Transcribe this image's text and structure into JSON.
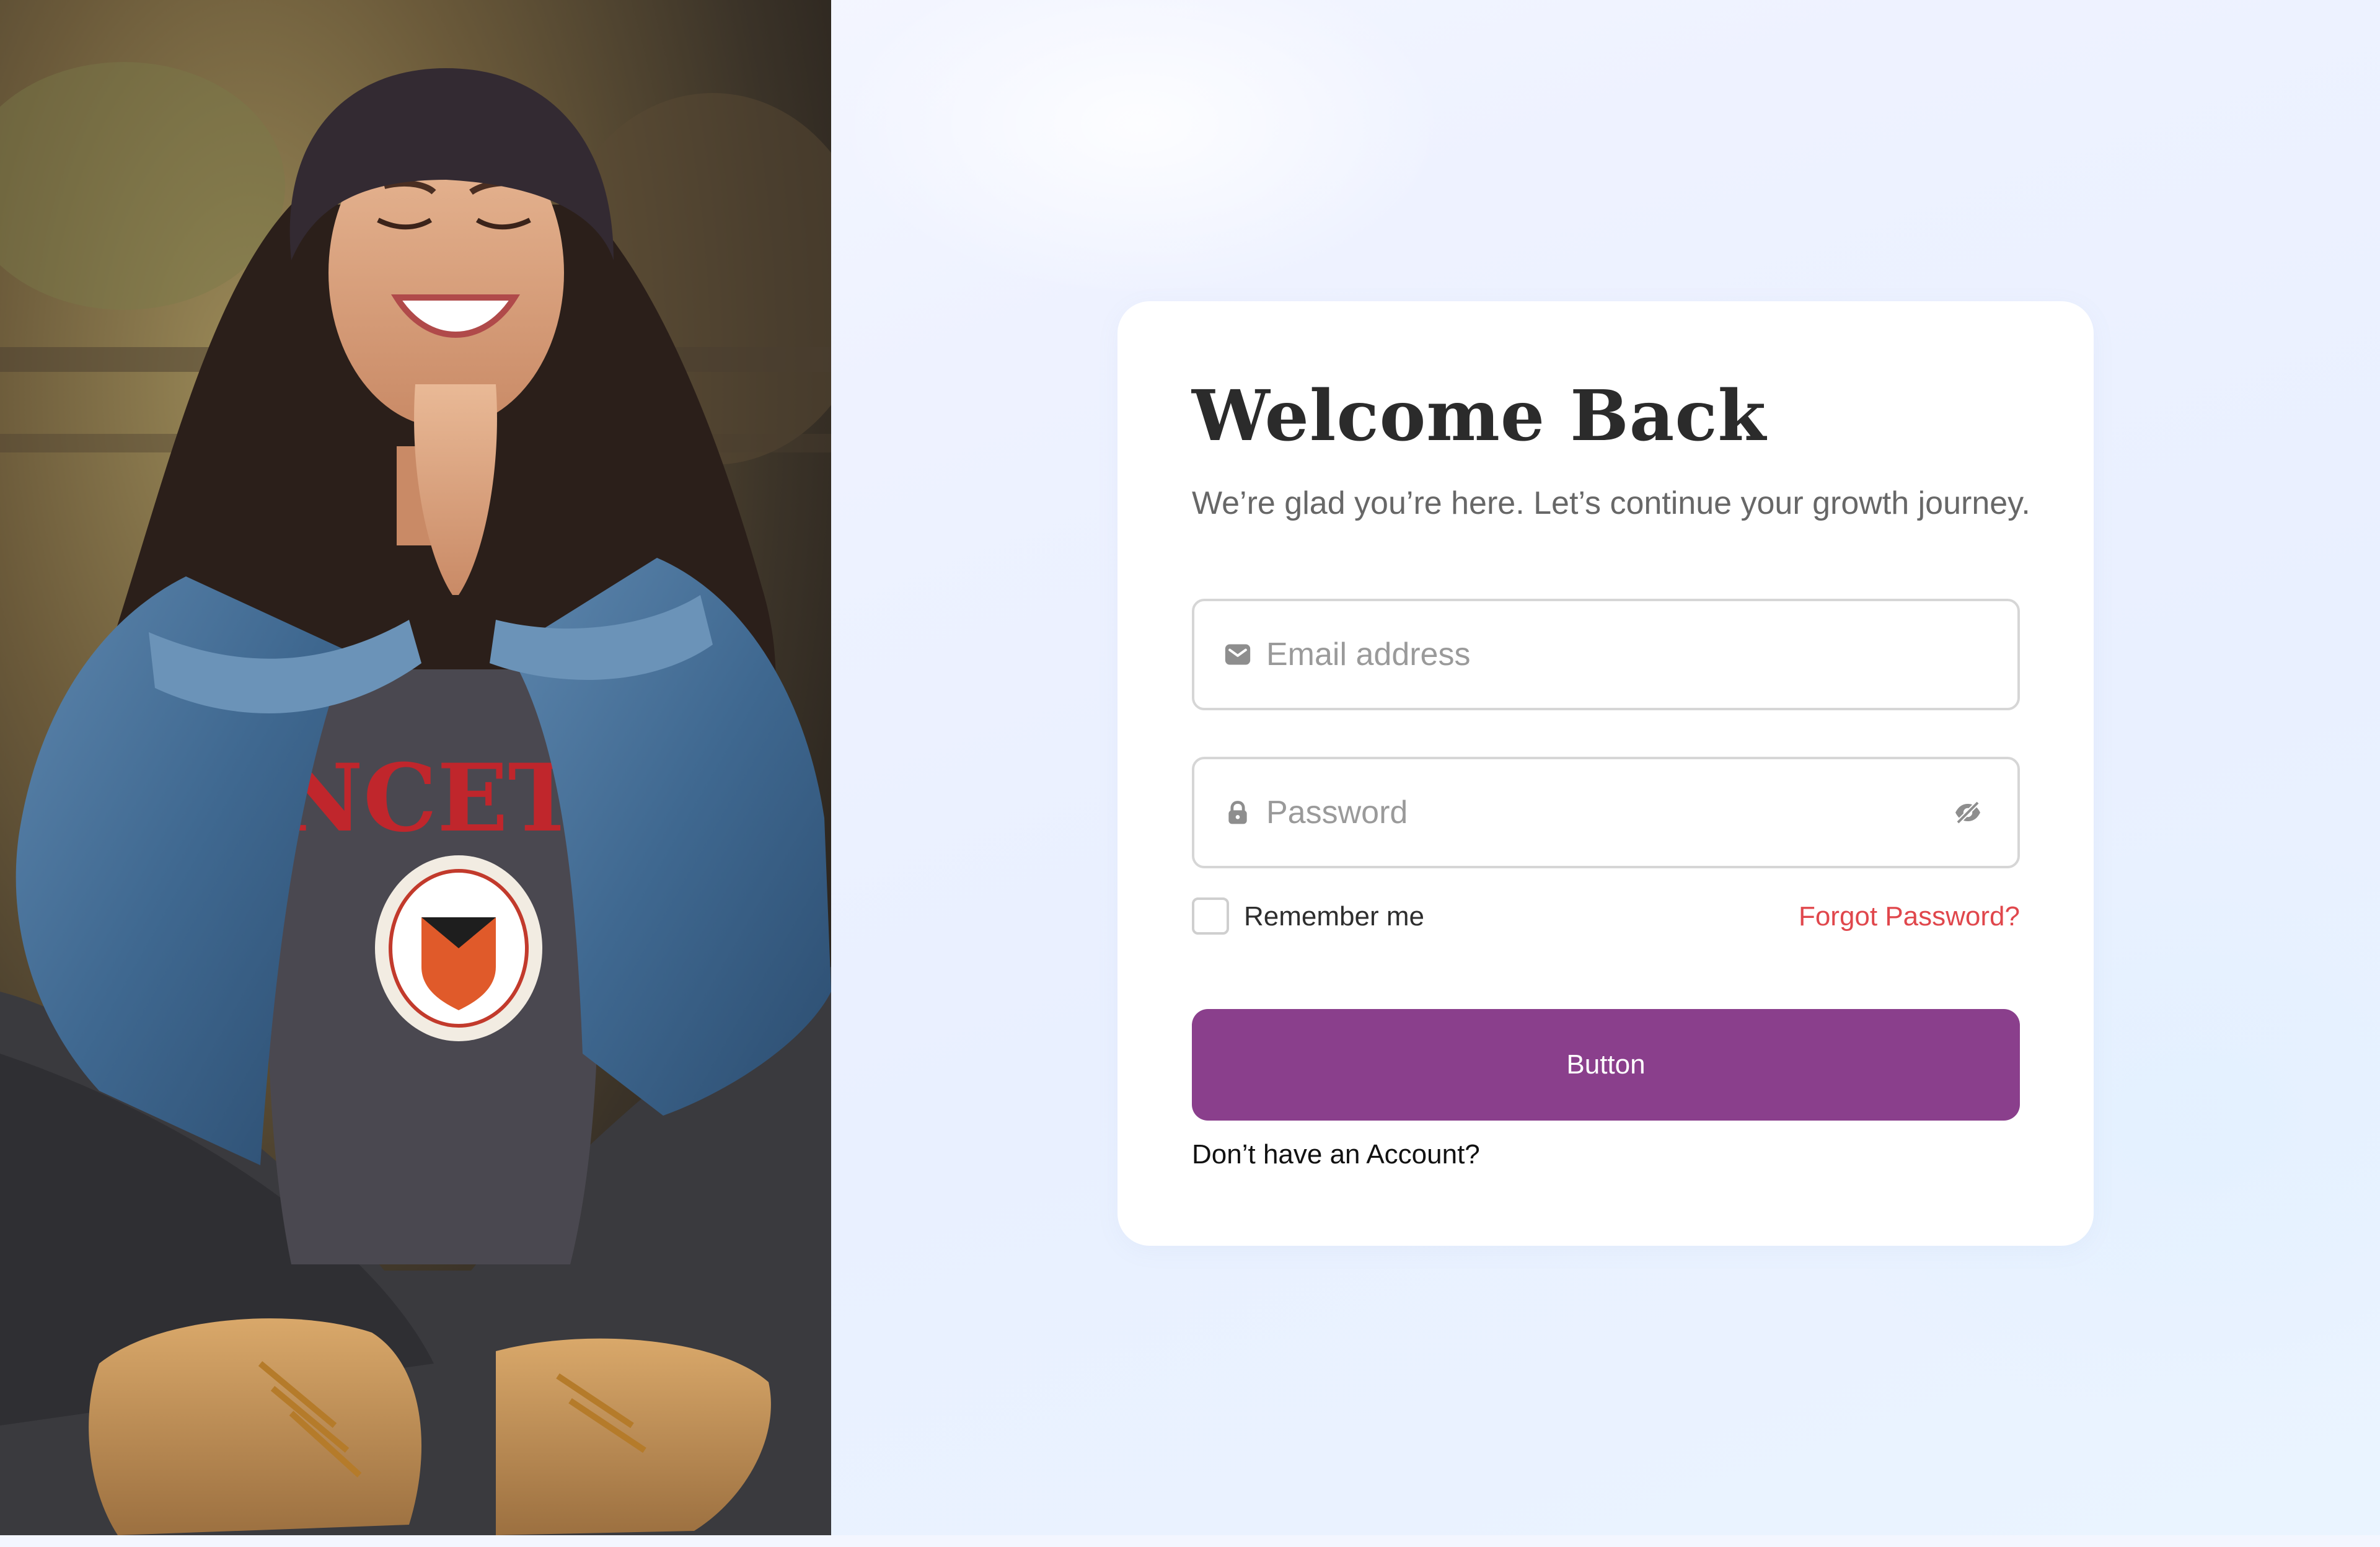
{
  "login": {
    "title": "Welcome Back",
    "subtitle": "We’re glad you’re here. Let’s continue your growth journey.",
    "email_placeholder": "Email address",
    "password_placeholder": "Password",
    "remember_label": "Remember me",
    "forgot_label": "Forgot Password?",
    "submit_label": "Button",
    "signup_prompt": "Don’t have an Account?"
  },
  "icons": {
    "email": "envelope-icon",
    "password": "lock-icon",
    "toggle": "eye-slash-icon"
  },
  "colors": {
    "primary": "#8a3f8c",
    "link": "#e0474c",
    "title": "#2b2b2b",
    "subtitle": "#676767",
    "card": "#ffffff",
    "page_background": "#eef2ff"
  }
}
